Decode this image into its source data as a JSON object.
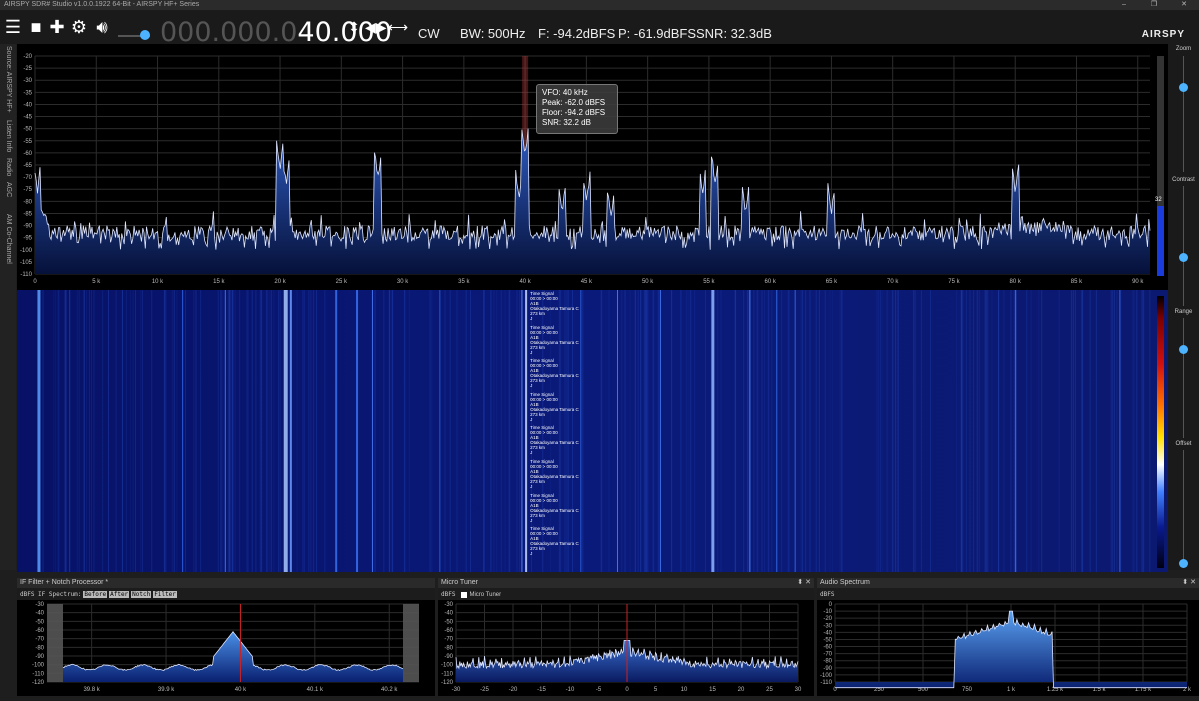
{
  "window": {
    "title": "AIRSPY SDR# Studio v1.0.0.1922 64-Bit - AIRSPY HF+ Series",
    "controls": [
      "–",
      "❐",
      "✕"
    ]
  },
  "toolbar": {
    "icons": [
      "menu-icon",
      "stop-icon",
      "plus-icon",
      "gear-icon",
      "speaker-icon"
    ],
    "volume": 0.8,
    "freq_dim": "000.000.0",
    "freq_lit": "40.000",
    "mode": "CW",
    "bw": "BW: 500Hz",
    "floor": "F: -94.2dBFS",
    "peak": "P: -61.9dBFS",
    "snr": "SNR: 32.3dB",
    "logo": "AIRSPY"
  },
  "side_tabs": [
    "Source: AIRSPY HF+ Series",
    "Listen Info",
    "Radio",
    "AGC",
    "AM Co-Channel Canceller"
  ],
  "spectrum": {
    "ylabel": "dBFS",
    "yticks": [
      "-20",
      "-25",
      "-30",
      "-35",
      "-40",
      "-45",
      "-50",
      "-55",
      "-60",
      "-65",
      "-70",
      "-75",
      "-80",
      "-85",
      "-90",
      "-95",
      "-100",
      "-105",
      "-110"
    ],
    "xticks": [
      "0",
      "5 k",
      "10 k",
      "15 k",
      "20 k",
      "25 k",
      "30 k",
      "35 k",
      "40 k",
      "45 k",
      "50 k",
      "55 k",
      "60 k",
      "65 k",
      "70 k",
      "75 k",
      "80 k",
      "85 k",
      "90 k"
    ],
    "tooltip": [
      "VFO:  40 kHz",
      "Peak: -62.0 dBFS",
      "Floor: -94.2 dBFS",
      "SNR:  32.2 dB"
    ],
    "level_marker": "32"
  },
  "waterfall": {
    "labels": [
      [
        "Time Signal",
        "00:00 > 00:00",
        "A1B",
        "Otakadoyama Tamura C",
        "273 km",
        "J"
      ],
      [
        "Time Signal",
        "00:00 > 00:00",
        "A1B",
        "Otakadoyama Tamura C",
        "273 km",
        "J"
      ],
      [
        "Time Signal",
        "00:00 > 00:00",
        "A1B",
        "Otakadoyama Tamura C",
        "273 km",
        "J"
      ],
      [
        "Time Signal",
        "00:00 > 00:00",
        "A1B",
        "Otakadoyama Tamura C",
        "273 km",
        "J"
      ],
      [
        "Time Signal",
        "00:00 > 00:00",
        "A1B",
        "Otakadoyama Tamura C",
        "273 km",
        "J"
      ],
      [
        "Time Signal",
        "00:00 > 00:00",
        "A1B",
        "Otakadoyama Tamura C",
        "273 km",
        "J"
      ],
      [
        "Time Signal",
        "00:00 > 00:00",
        "A1B",
        "Otakadoyama Tamura C",
        "273 km",
        "J"
      ],
      [
        "Time Signal",
        "00:00 > 00:00",
        "A1B",
        "Otakadoyama Tamura C",
        "273 km",
        "J"
      ]
    ]
  },
  "rightbar": {
    "zoom": "Zoom",
    "contrast": "Contrast",
    "range": "Range",
    "offset": "Offset",
    "zoom_level": 0.73,
    "contrast_level": 0.41,
    "range_level": 0.74,
    "offset_level": 0.04
  },
  "if_filter": {
    "title": "IF Filter + Notch Processor *",
    "sub": "dBFS  IF Spectrum:",
    "tags": [
      "Before",
      "After",
      "Notch",
      "Filter"
    ],
    "yticks": [
      "-30",
      "-40",
      "-50",
      "-60",
      "-70",
      "-80",
      "-90",
      "-100",
      "-110",
      "-120"
    ],
    "xticks": [
      "39.8 k",
      "39.9 k",
      "40 k",
      "40.1 k",
      "40.2 k"
    ]
  },
  "micro_tuner": {
    "title": "Micro Tuner",
    "controls": [
      "⬍",
      "✕"
    ],
    "sub": "dBFS",
    "check": "Micro Tuner",
    "yticks": [
      "-30",
      "-40",
      "-50",
      "-60",
      "-70",
      "-80",
      "-90",
      "-100",
      "-110",
      "-120"
    ],
    "xticks": [
      "-30",
      "-25",
      "-20",
      "-15",
      "-10",
      "-5",
      "0",
      "5",
      "10",
      "15",
      "20",
      "25",
      "30"
    ]
  },
  "audio_spectrum": {
    "title": "Audio Spectrum",
    "controls": [
      "⬍",
      "✕"
    ],
    "sub": "dBFS",
    "yticks": [
      "0",
      "-10",
      "-20",
      "-30",
      "-40",
      "-50",
      "-60",
      "-70",
      "-80",
      "-90",
      "-100",
      "-110"
    ],
    "xticks": [
      "0",
      "250",
      "500",
      "750",
      "1 k",
      "1.25 k",
      "1.5 k",
      "1.75 k",
      "2 k"
    ]
  },
  "colors": {
    "accent": "#4db3ff",
    "trace": "#dfe6ff",
    "fill": "#1b3f8a",
    "marker": "#cc2222"
  }
}
